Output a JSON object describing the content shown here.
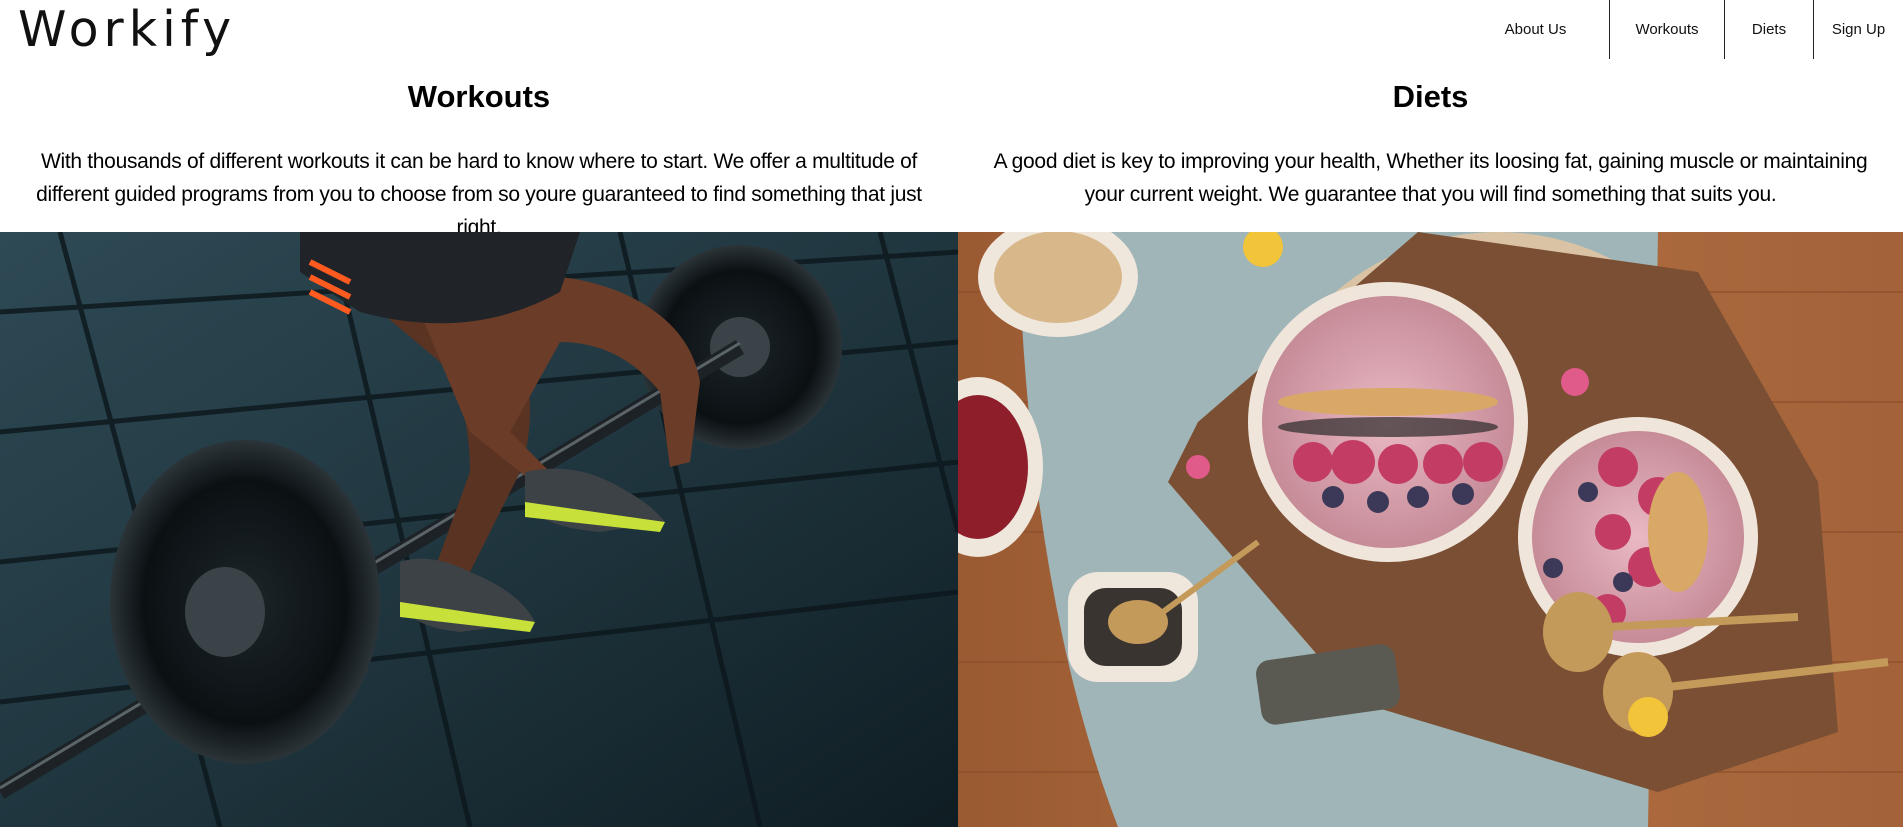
{
  "header": {
    "logo": "Workify",
    "nav": [
      "About Us",
      "Workouts",
      "Diets",
      "Sign Up"
    ]
  },
  "sections": {
    "workouts": {
      "title": "Workouts",
      "text": "With thousands of different workouts it can be hard to know where to start. We offer a multitude of different guided programs from you to choose from so youre guaranteed to find something that just right."
    },
    "diets": {
      "title": "Diets",
      "text": "A good diet is key to improving your health, Whether its loosing fat, gaining muscle or maintaining your current weight. We guarantee that you will find something that suits you."
    }
  },
  "colors": {
    "background": "#ffffff",
    "text": "#000000",
    "nav_divider": "#222222"
  }
}
